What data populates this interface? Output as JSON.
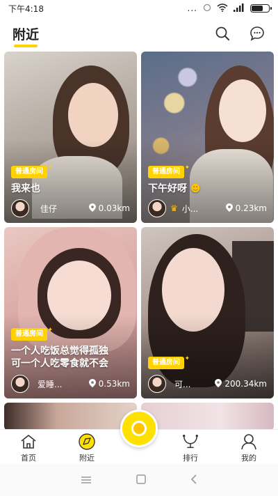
{
  "status_bar": {
    "time": "下午4:18",
    "dots": "..."
  },
  "header": {
    "title": "附近"
  },
  "cards": [
    {
      "tag": "普通房间",
      "title": "我来也",
      "user": "佳仔",
      "distance": "0.03km"
    },
    {
      "tag": "普通房间",
      "title": "下午好呀",
      "user": "小...",
      "distance": "0.23km"
    },
    {
      "tag": "普通房间",
      "title": "一个人吃饭总觉得孤独\n可一个人吃零食就不会",
      "user": "爱睡...",
      "distance": "0.53km"
    },
    {
      "tag": "普通房间",
      "title": "",
      "user": "可...",
      "distance": "200.34km"
    }
  ],
  "nav": {
    "home": "首页",
    "nearby": "附近",
    "ranking": "排行",
    "mine": "我的"
  },
  "colors": {
    "accent": "#FFD200"
  }
}
